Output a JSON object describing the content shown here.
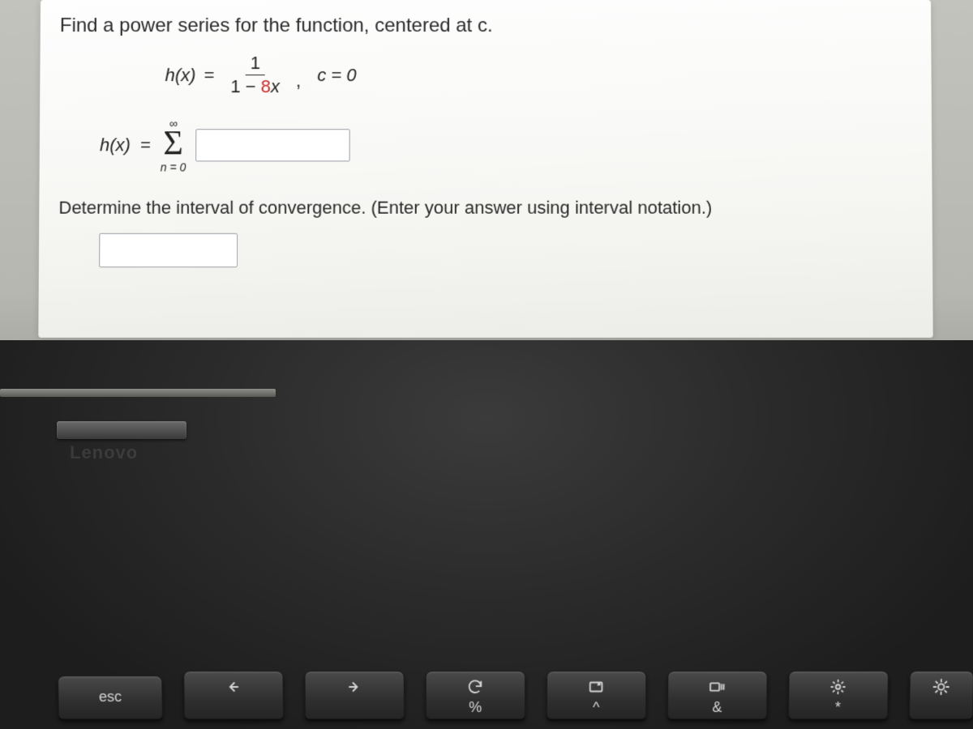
{
  "problem": {
    "prompt_main": "Find a power series for the function, centered at c.",
    "function_lhs": "h(x)",
    "equals": "=",
    "numerator": "1",
    "denom_left": "1 − ",
    "denom_coeff": "8",
    "denom_var": "x",
    "center_label": "c = 0",
    "sum_lhs": "h(x)",
    "sigma_upper": "∞",
    "sigma_lower": "n = 0",
    "prompt_interval": "Determine the interval of convergence. (Enter your answer using interval notation.)"
  },
  "laptop": {
    "brand": "Lenovo"
  },
  "keys": {
    "esc": "esc",
    "percent": "%",
    "ampersand": "&",
    "caret": "^",
    "asterisk": "*"
  }
}
